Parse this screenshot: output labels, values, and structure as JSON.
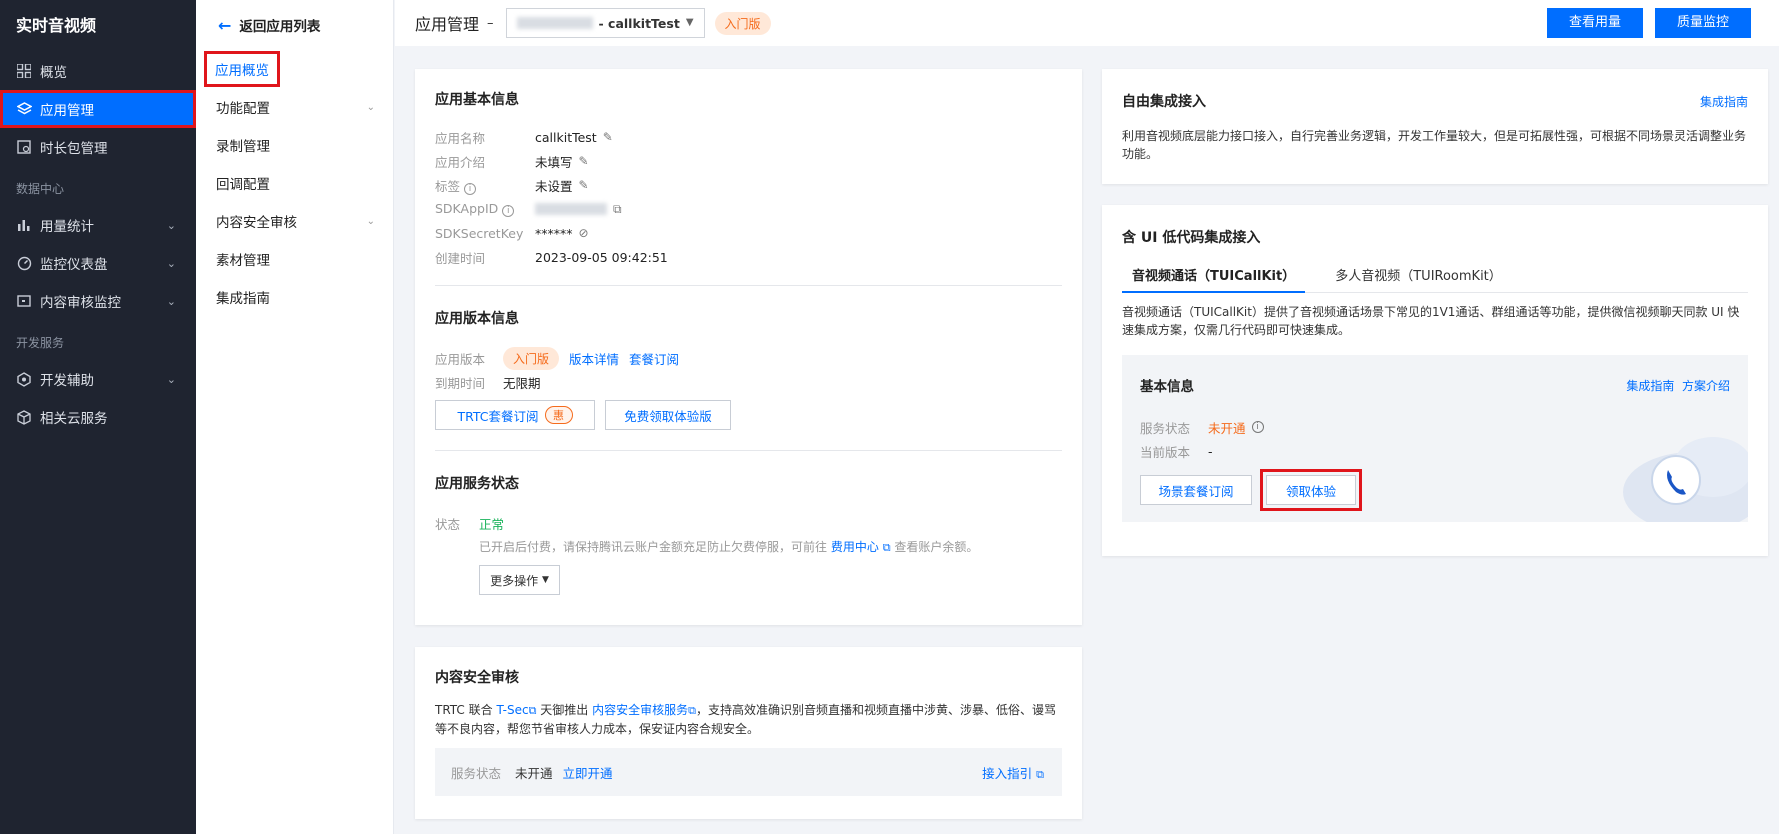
{
  "sidebar": {
    "brand": "实时音视频",
    "items": [
      {
        "label": "概览",
        "icon": "grid-icon"
      },
      {
        "label": "应用管理",
        "icon": "layers-icon"
      },
      {
        "label": "时长包管理",
        "icon": "package-icon"
      }
    ],
    "group_data": "数据中心",
    "data_items": [
      {
        "label": "用量统计",
        "icon": "bar-chart-icon"
      },
      {
        "label": "监控仪表盘",
        "icon": "gauge-icon"
      },
      {
        "label": "内容审核监控",
        "icon": "monitor-icon"
      }
    ],
    "group_dev": "开发服务",
    "dev_items": [
      {
        "label": "开发辅助",
        "icon": "hexagon-icon"
      },
      {
        "label": "相关云服务",
        "icon": "cube-icon"
      }
    ]
  },
  "submenu": {
    "back": "返回应用列表",
    "items": [
      "应用概览",
      "功能配置",
      "录制管理",
      "回调配置",
      "内容安全审核",
      "素材管理",
      "集成指南"
    ]
  },
  "header": {
    "title": "应用管理",
    "dash": "–",
    "app_name": "- callkitTest",
    "edition": "入门版",
    "btn_usage": "查看用量",
    "btn_quality": "质量监控"
  },
  "basic": {
    "title": "应用基本信息",
    "rows": [
      {
        "k": "应用名称",
        "v": "callkitTest"
      },
      {
        "k": "应用介绍",
        "v": "未填写"
      },
      {
        "k": "标签",
        "v": "未设置"
      },
      {
        "k": "SDKAppID",
        "v": ""
      },
      {
        "k": "SDKSecretKey",
        "v": "******"
      },
      {
        "k": "创建时间",
        "v": "2023-09-05 09:42:51"
      }
    ]
  },
  "version": {
    "title": "应用版本信息",
    "k_version": "应用版本",
    "edition": "入门版",
    "detail": "版本详情",
    "subscribe": "套餐订阅",
    "k_expire": "到期时间",
    "expire": "无限期",
    "btn_trtc": "TRTC套餐订阅",
    "hui": "惠",
    "btn_free": "免费领取体验版"
  },
  "status": {
    "title": "应用服务状态",
    "k": "状态",
    "v": "正常",
    "note_a": "已开启后付费，请保持腾讯云账户金额充足防止欠费停服，可前往",
    "note_link": "费用中心",
    "note_b": "查看账户余额。",
    "btn_more": "更多操作"
  },
  "content": {
    "title": "内容安全审核",
    "p1": "TRTC 联合",
    "tsec": "T-Sec",
    "p2": "天御推出",
    "svc": "内容安全审核服务",
    "p3": "，支持高效准确识别音频直播和视频直播中涉黄、涉暴、低俗、谩骂等不良内容，帮您节省审核人力成本，保安证内容合规安全。",
    "k_status": "服务状态",
    "v_status": "未开通",
    "open": "立即开通",
    "guide": "接入指引"
  },
  "free": {
    "title": "自由集成接入",
    "link": "集成指南",
    "desc": "利用音视频底层能力接口接入，自行完善业务逻辑，开发工作量较大，但是可拓展性强，可根据不同场景灵活调整业务功能。"
  },
  "lowcode": {
    "title": "含 UI 低代码集成接入",
    "tab1": "音视频通话（TUICallKit）",
    "tab2": "多人音视频（TUIRoomKit）",
    "desc": "音视频通话（TUICallKit）提供了音视频通话场景下常见的1V1通话、群组通话等功能，提供微信视频聊天同款 UI 快速集成方案，仅需几行代码即可快速集成。",
    "inner_title": "基本信息",
    "guide": "集成指南",
    "intro": "方案介绍",
    "k_service": "服务状态",
    "v_service": "未开通",
    "k_version": "当前版本",
    "v_version": "-",
    "btn_scene": "场景套餐订阅",
    "btn_trial": "领取体验"
  },
  "colors": {
    "accent": "#006eff",
    "sidebar_bg": "#1f2430",
    "warn": "#f56b1c",
    "ok": "#1ab35b",
    "highlight": "#e0151b"
  }
}
